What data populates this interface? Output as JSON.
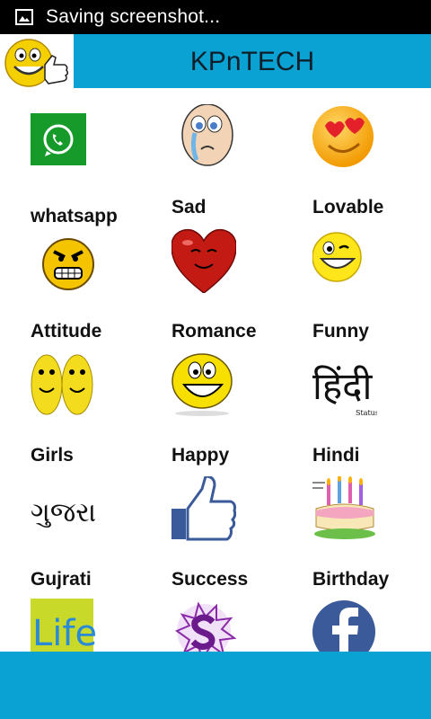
{
  "status_bar": {
    "text": "Saving screenshot..."
  },
  "app_bar": {
    "title": "KPnTECH"
  },
  "categories": [
    {
      "label": "whatsapp",
      "icon": "whatsapp-icon"
    },
    {
      "label": "Sad",
      "icon": "sad-face-icon"
    },
    {
      "label": "Lovable",
      "icon": "heart-eyes-icon"
    },
    {
      "label": "Attitude",
      "icon": "angry-face-icon"
    },
    {
      "label": "Romance",
      "icon": "heart-face-icon"
    },
    {
      "label": "Funny",
      "icon": "wink-face-icon"
    },
    {
      "label": "Girls",
      "icon": "girls-faces-icon"
    },
    {
      "label": "Happy",
      "icon": "happy-face-icon"
    },
    {
      "label": "Hindi",
      "icon": "hindi-text-icon"
    },
    {
      "label": "Gujrati",
      "icon": "gujarati-text-icon"
    },
    {
      "label": "Success",
      "icon": "thumbs-up-icon"
    },
    {
      "label": "Birthday",
      "icon": "birthday-cake-icon"
    },
    {
      "label": "",
      "icon": "life-text-icon"
    },
    {
      "label": "",
      "icon": "s-logo-icon"
    },
    {
      "label": "",
      "icon": "facebook-icon"
    }
  ],
  "icon_texts": {
    "hindi": "हिंदी",
    "hindi_sub": "Status",
    "gujarati": "ગુજરાતી",
    "life": "Life"
  }
}
